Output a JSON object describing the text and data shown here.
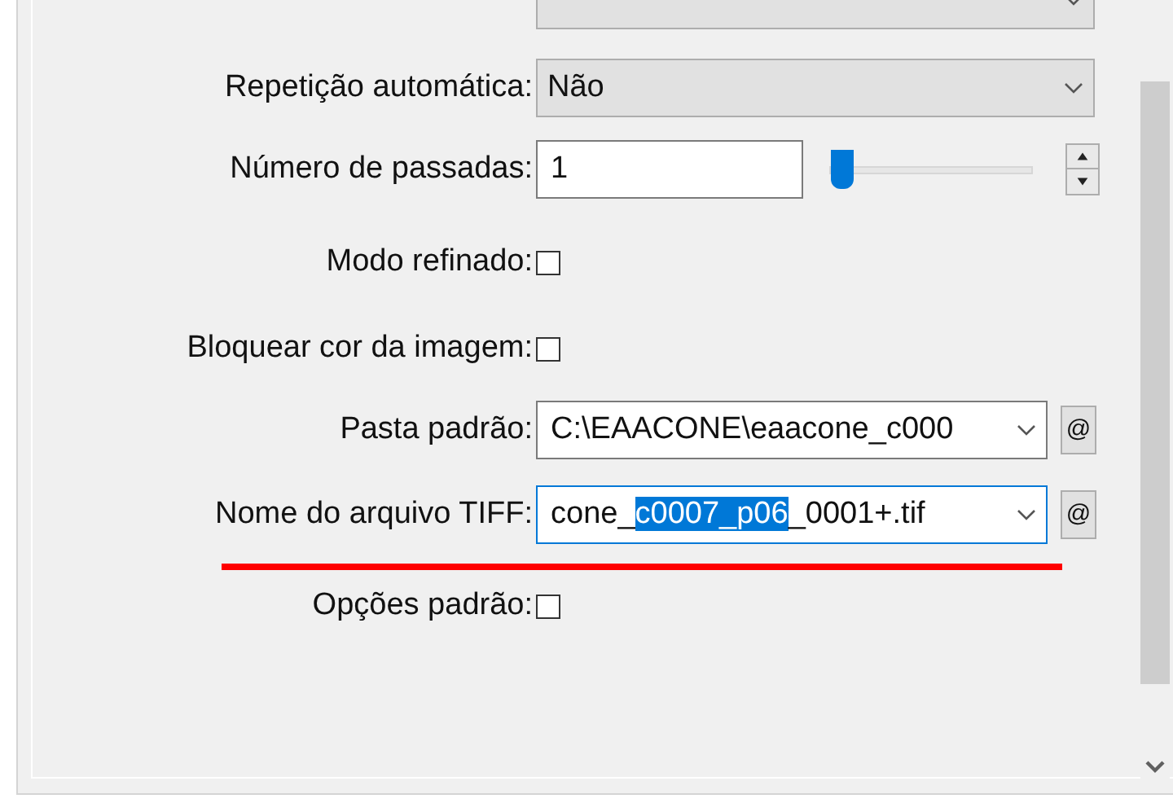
{
  "rows": [
    {
      "kind": "select",
      "label": "",
      "value": "",
      "disabled": true
    },
    {
      "kind": "select",
      "label": "Repetição automática:",
      "value": "Não",
      "disabled": true
    },
    {
      "kind": "number",
      "label": "Número de passadas:",
      "value": "1",
      "level": 0.02
    },
    {
      "kind": "checkbox",
      "label": "Modo refinado:",
      "checked": false
    },
    {
      "kind": "checkbox",
      "label": "Bloquear cor da imagem:",
      "checked": false
    },
    {
      "kind": "combo",
      "label": "Pasta padrão:",
      "focused": false,
      "underlined": false,
      "value_parts": [
        {
          "text": "C:\\EAACONE\\eaacone_c000",
          "selected": false
        }
      ],
      "button": "@"
    },
    {
      "kind": "combo",
      "label": "Nome do arquivo TIFF:",
      "focused": true,
      "underlined": true,
      "value_parts": [
        {
          "text": "cone_",
          "selected": false
        },
        {
          "text": "c0007_p06",
          "selected": true
        },
        {
          "text": "_0001+.tif",
          "selected": false
        }
      ],
      "button": "@"
    },
    {
      "kind": "checkbox",
      "label": "Opções padrão:",
      "checked": false
    }
  ]
}
